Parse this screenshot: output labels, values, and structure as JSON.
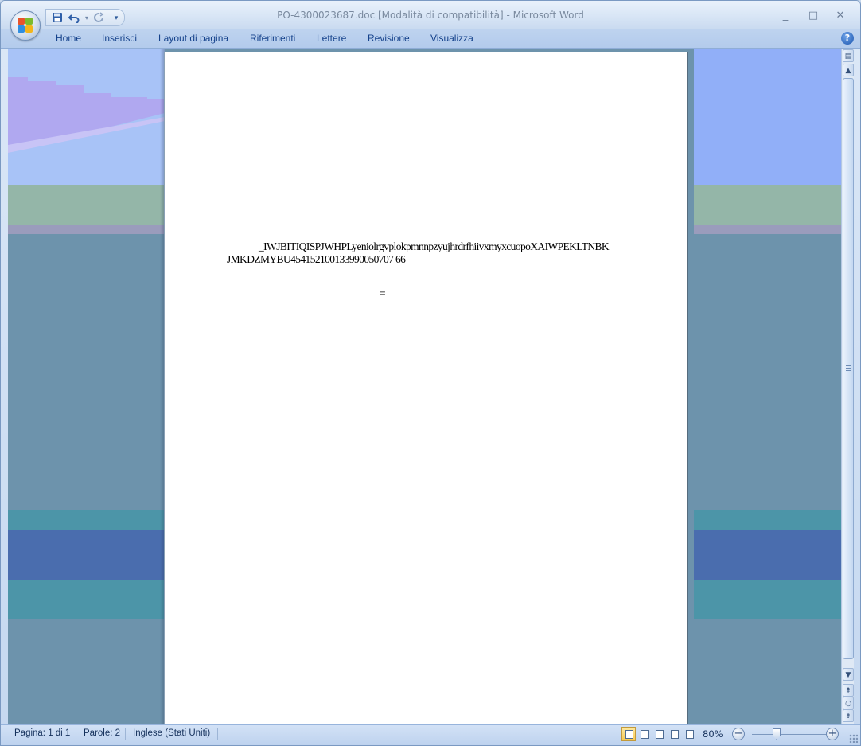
{
  "window": {
    "title": "PO-4300023687.doc [Modalità di compatibilità] - Microsoft Word",
    "minimize_glyph": "_",
    "maximize_glyph": "□",
    "close_glyph": "✕"
  },
  "qat": {
    "save_icon": "save-icon",
    "undo_icon": "undo-icon",
    "redo_icon": "redo-icon",
    "customize_icon": "chevron-down-icon"
  },
  "ribbon": {
    "tabs": [
      {
        "label": "Home"
      },
      {
        "label": "Inserisci"
      },
      {
        "label": "Layout di pagina"
      },
      {
        "label": "Riferimenti"
      },
      {
        "label": "Lettere"
      },
      {
        "label": "Revisione"
      },
      {
        "label": "Visualizza"
      }
    ],
    "help_label": "?"
  },
  "document": {
    "line1": "_IWJBITIQISPJWHPLyeniolrgvplokpmnnpzyujhrdrfhiivxmyxcuopoXAIWPEKLTNBK",
    "line2": "JMKDZMYBU454152100133990050707 66",
    "line3": "="
  },
  "status": {
    "page": "Pagina: 1 di 1",
    "words": "Parole: 2",
    "language": "Inglese (Stati Uniti)",
    "zoom": "80%",
    "zoom_fraction": 0.8
  },
  "colors": {
    "accent": "#15428b",
    "page_bg": "#ffffff",
    "doc_bg": "#6d93ac"
  }
}
